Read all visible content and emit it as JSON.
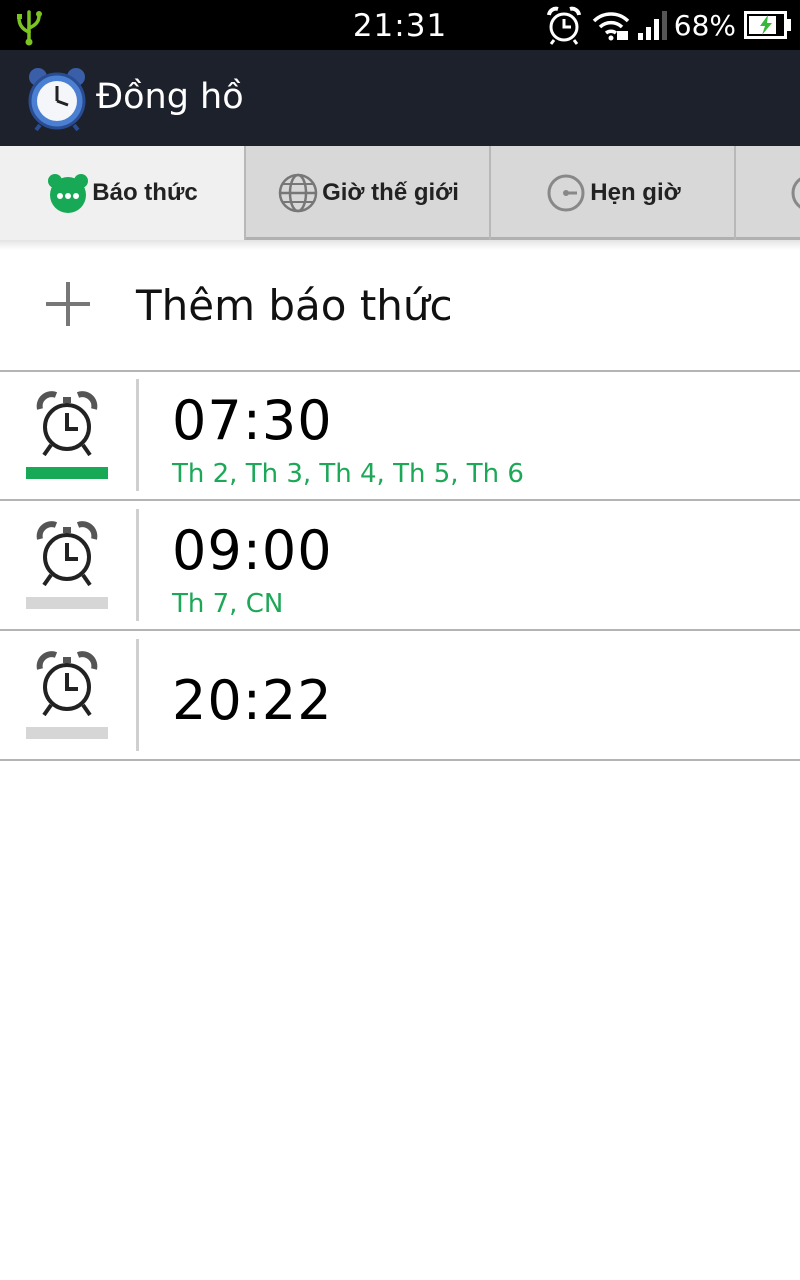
{
  "status_bar": {
    "time": "21:31",
    "battery_percent": "68%",
    "icons": [
      "usb-icon",
      "alarm-status-icon",
      "wifi-icon",
      "signal-icon",
      "battery-charging-icon"
    ]
  },
  "app": {
    "title": "Đồng hồ",
    "icon": "alarm-clock-app-icon"
  },
  "tabs": [
    {
      "label": "Báo thức",
      "icon": "alarm-tab-icon",
      "active": true
    },
    {
      "label": "Giờ thế giới",
      "icon": "globe-icon",
      "active": false
    },
    {
      "label": "Hẹn giờ",
      "icon": "timer-icon",
      "active": false
    },
    {
      "label": "",
      "icon": "stopwatch-icon",
      "active": false
    }
  ],
  "add_alarm": {
    "label": "Thêm báo thức",
    "icon": "plus-icon"
  },
  "alarms": [
    {
      "time": "07:30",
      "days": "Th 2, Th 3, Th 4, Th 5, Th 6",
      "enabled": true
    },
    {
      "time": "09:00",
      "days": "Th 7, CN",
      "enabled": false
    },
    {
      "time": "20:22",
      "days": "",
      "enabled": false
    }
  ],
  "colors": {
    "accent_green": "#18a957",
    "action_bar": "#1c212b",
    "status_bar": "#000000"
  }
}
